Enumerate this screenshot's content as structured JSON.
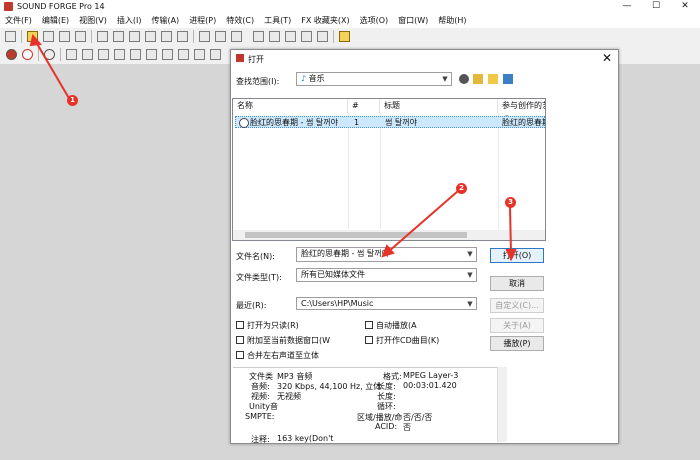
{
  "window": {
    "title": "SOUND FORGE Pro 14",
    "controls": [
      "—",
      "☐",
      "✕"
    ]
  },
  "menu": [
    "文件(F)",
    "编辑(E)",
    "视图(V)",
    "插入(I)",
    "传输(A)",
    "进程(P)",
    "特效(C)",
    "工具(T)",
    "FX 收藏夹(X)",
    "选项(O)",
    "窗口(W)",
    "帮助(H)"
  ],
  "dialog": {
    "title": "打开",
    "close": "✕",
    "lookin_label": "查找范围(I):",
    "lookin_value": "音乐",
    "columns": {
      "name": "名称",
      "num": "#",
      "title": "标题",
      "artist": "参与创作的艺术"
    },
    "row": {
      "name": "脸红的思春期 - 썸 탈꺼야",
      "num": "1",
      "title": "썸 탈꺼야",
      "artist": "脸红的思春期"
    },
    "filename_label": "文件名(N):",
    "filename_value": "脸红的思春期 - 썸 탈꺼야",
    "filetype_label": "文件类型(T):",
    "filetype_value": "所有已知媒体文件",
    "recent_label": "最近(R):",
    "recent_value": "C:\\Users\\HP\\Music",
    "open_button": "打开(O)",
    "cancel_button": "取消",
    "custom_button": "自定义(C)...",
    "about_button": "关于(A)",
    "play_button": "播放(P)",
    "checks": {
      "readonly": "打开为只读(R)",
      "autoplay": "自动播放(A",
      "attach": "附加至当前数据窗口(W",
      "cd": "打开作CD曲目(K)",
      "merge": "合并左右声道至立体"
    },
    "info": {
      "filetype_label": "文件类",
      "filetype_value": "MP3 音频",
      "audio_label": "音频:",
      "audio_value": "320 Kbps, 44,100 Hz, 立体",
      "video_label": "视频:",
      "video_value": "无视频",
      "unity": "Unity音",
      "smpte_label": "SMPTE:",
      "format_label": "格式:",
      "format_value": "MPEG Layer-3",
      "length_label": "长度:",
      "length_value": "00:03:01.420",
      "length2_label": "长度:",
      "loop_label": "循环:",
      "region_label": "区域/播放/命",
      "region_value": "否/否/否",
      "acid_label": "ACID:",
      "acid_value": "否",
      "comment_label": "注释:",
      "comment_value": "163 key(Don't"
    }
  },
  "annotations": [
    "1",
    "2",
    "3"
  ],
  "colors": {
    "annotation": "#e5332a",
    "selection": "#cce8ff"
  }
}
